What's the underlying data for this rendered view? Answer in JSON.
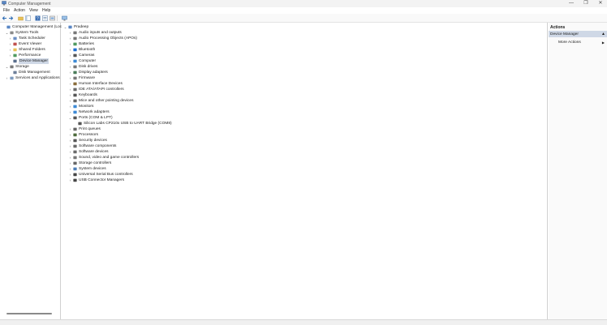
{
  "window": {
    "title": "Computer Management",
    "minimize": "—",
    "maximize": "❐",
    "close": "✕"
  },
  "menu": [
    "File",
    "Action",
    "View",
    "Help"
  ],
  "toolbar_icons": [
    "back-arrow-icon",
    "forward-arrow-icon",
    "folder-up-icon",
    "show-hide-tree-icon",
    "help-icon",
    "properties-icon",
    "export-icon",
    "refresh-icon",
    "device-scan-icon"
  ],
  "left_tree": [
    {
      "label": "Computer Management (Local",
      "exp": "",
      "level": 0,
      "icon": "computer-management-icon"
    },
    {
      "label": "System Tools",
      "exp": "⌄",
      "level": 1,
      "icon": "system-tools-icon"
    },
    {
      "label": "Task Scheduler",
      "exp": "›",
      "level": 2,
      "icon": "clock-icon"
    },
    {
      "label": "Event Viewer",
      "exp": "›",
      "level": 2,
      "icon": "event-viewer-icon"
    },
    {
      "label": "Shared Folders",
      "exp": "›",
      "level": 2,
      "icon": "folder-icon"
    },
    {
      "label": "Performance",
      "exp": "›",
      "level": 2,
      "icon": "performance-icon"
    },
    {
      "label": "Device Manager",
      "exp": "",
      "level": 2,
      "icon": "device-manager-icon",
      "selected": true
    },
    {
      "label": "Storage",
      "exp": "⌄",
      "level": 1,
      "icon": "storage-icon"
    },
    {
      "label": "Disk Management",
      "exp": "",
      "level": 2,
      "icon": "disk-icon"
    },
    {
      "label": "Services and Applications",
      "exp": "›",
      "level": 1,
      "icon": "services-icon"
    }
  ],
  "device_tree": [
    {
      "label": "Pradeep",
      "exp": "⌄",
      "level": 0,
      "icon": "computer-icon"
    },
    {
      "label": "Audio inputs and outputs",
      "exp": "›",
      "level": 1,
      "icon": "speaker-icon"
    },
    {
      "label": "Audio Processing Objects (APOs)",
      "exp": "›",
      "level": 1,
      "icon": "speaker-icon"
    },
    {
      "label": "Batteries",
      "exp": "›",
      "level": 1,
      "icon": "battery-icon"
    },
    {
      "label": "Bluetooth",
      "exp": "›",
      "level": 1,
      "icon": "bluetooth-icon"
    },
    {
      "label": "Cameras",
      "exp": "›",
      "level": 1,
      "icon": "camera-icon"
    },
    {
      "label": "Computer",
      "exp": "›",
      "level": 1,
      "icon": "monitor-icon"
    },
    {
      "label": "Disk drives",
      "exp": "›",
      "level": 1,
      "icon": "disk-drive-icon"
    },
    {
      "label": "Display adapters",
      "exp": "›",
      "level": 1,
      "icon": "display-adapter-icon"
    },
    {
      "label": "Firmware",
      "exp": "›",
      "level": 1,
      "icon": "firmware-icon"
    },
    {
      "label": "Human Interface Devices",
      "exp": "›",
      "level": 1,
      "icon": "hid-icon"
    },
    {
      "label": "IDE ATA/ATAPI controllers",
      "exp": "›",
      "level": 1,
      "icon": "ide-icon"
    },
    {
      "label": "Keyboards",
      "exp": "›",
      "level": 1,
      "icon": "keyboard-icon"
    },
    {
      "label": "Mice and other pointing devices",
      "exp": "›",
      "level": 1,
      "icon": "mouse-icon"
    },
    {
      "label": "Monitors",
      "exp": "›",
      "level": 1,
      "icon": "monitor-icon"
    },
    {
      "label": "Network adapters",
      "exp": "›",
      "level": 1,
      "icon": "network-icon"
    },
    {
      "label": "Ports (COM & LPT)",
      "exp": "⌄",
      "level": 1,
      "icon": "port-icon"
    },
    {
      "label": "Silicon Labs CP210x USB to UART Bridge (COM8)",
      "exp": "",
      "level": 2,
      "icon": "port-icon"
    },
    {
      "label": "Print queues",
      "exp": "›",
      "level": 1,
      "icon": "printer-icon"
    },
    {
      "label": "Processors",
      "exp": "›",
      "level": 1,
      "icon": "processor-icon"
    },
    {
      "label": "Security devices",
      "exp": "›",
      "level": 1,
      "icon": "security-icon"
    },
    {
      "label": "Software components",
      "exp": "›",
      "level": 1,
      "icon": "software-icon"
    },
    {
      "label": "Software devices",
      "exp": "›",
      "level": 1,
      "icon": "software-icon"
    },
    {
      "label": "Sound, video and game controllers",
      "exp": "›",
      "level": 1,
      "icon": "speaker-icon"
    },
    {
      "label": "Storage controllers",
      "exp": "›",
      "level": 1,
      "icon": "storage-controller-icon"
    },
    {
      "label": "System devices",
      "exp": "›",
      "level": 1,
      "icon": "system-device-icon"
    },
    {
      "label": "Universal Serial Bus controllers",
      "exp": "›",
      "level": 1,
      "icon": "usb-icon"
    },
    {
      "label": "USB Connector Managers",
      "exp": "›",
      "level": 1,
      "icon": "usb-icon"
    }
  ],
  "actions": {
    "header": "Actions",
    "section": "Device Manager",
    "section_arrow": "▲",
    "more": "More Actions",
    "more_arrow": "▶"
  },
  "colors": {
    "selection": "#cfd8e6",
    "accent": "#2f6db5"
  }
}
